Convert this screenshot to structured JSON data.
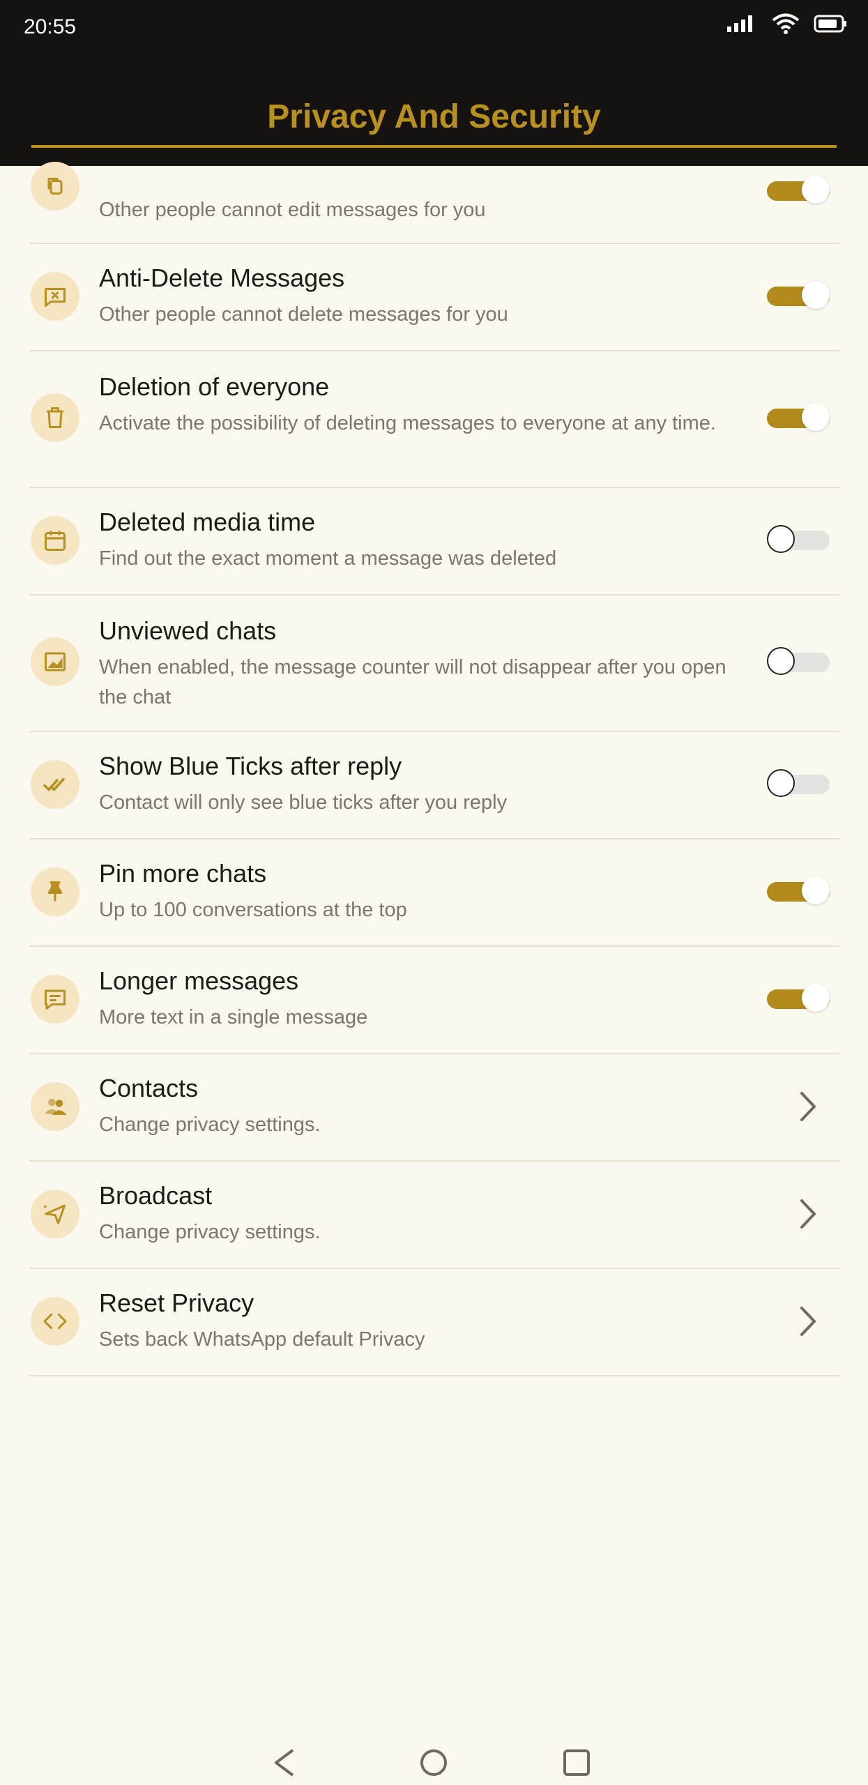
{
  "status_bar": {
    "time": "20:55",
    "signal_icon": "signal-icon",
    "wifi_icon": "wifi-icon",
    "battery_icon": "battery-icon"
  },
  "app_bar": {
    "title": "Privacy And Security"
  },
  "colors": {
    "accent": "#b8901f",
    "toggle_on": "#b28a1c",
    "toggle_off": "#e3e2de",
    "background": "#fbf8f0",
    "header": "#16120f"
  },
  "rows": [
    {
      "icon": "copy-icon",
      "title": "",
      "subtitle": "Other people cannot edit messages for you",
      "control": "toggle",
      "on": true
    },
    {
      "icon": "chat-x-icon",
      "title": "Anti-Delete Messages",
      "subtitle": "Other people cannot delete messages for you",
      "control": "toggle",
      "on": true
    },
    {
      "icon": "trash-icon",
      "title": "Deletion of everyone",
      "subtitle": "Activate the possibility of deleting messages to everyone at any time.",
      "control": "toggle",
      "on": true
    },
    {
      "icon": "calendar-icon",
      "title": "Deleted media time",
      "subtitle": "Find out the exact moment a message was deleted",
      "control": "toggle",
      "on": false
    },
    {
      "icon": "image-icon",
      "title": "Unviewed chats",
      "subtitle": "When enabled, the message counter will not disappear after you open the chat",
      "control": "toggle",
      "on": false
    },
    {
      "icon": "double-check-icon",
      "title": "Show Blue Ticks after reply",
      "subtitle": "Contact will only see blue ticks after you reply",
      "control": "toggle",
      "on": false
    },
    {
      "icon": "pin-icon",
      "title": "Pin more chats",
      "subtitle": "Up to 100 conversations at the top",
      "control": "toggle",
      "on": true
    },
    {
      "icon": "message-icon",
      "title": "Longer messages",
      "subtitle": "More text in a single message",
      "control": "toggle",
      "on": true
    },
    {
      "icon": "contacts-icon",
      "title": "Contacts",
      "subtitle": "Change privacy settings.",
      "control": "chevron"
    },
    {
      "icon": "send-icon",
      "title": "Broadcast",
      "subtitle": "Change privacy settings.",
      "control": "chevron"
    },
    {
      "icon": "code-icon",
      "title": "Reset Privacy",
      "subtitle": "Sets back WhatsApp default Privacy",
      "control": "chevron"
    }
  ],
  "nav_bar": {
    "back_icon": "back-icon",
    "home_icon": "home-icon",
    "recents_icon": "recents-icon"
  }
}
